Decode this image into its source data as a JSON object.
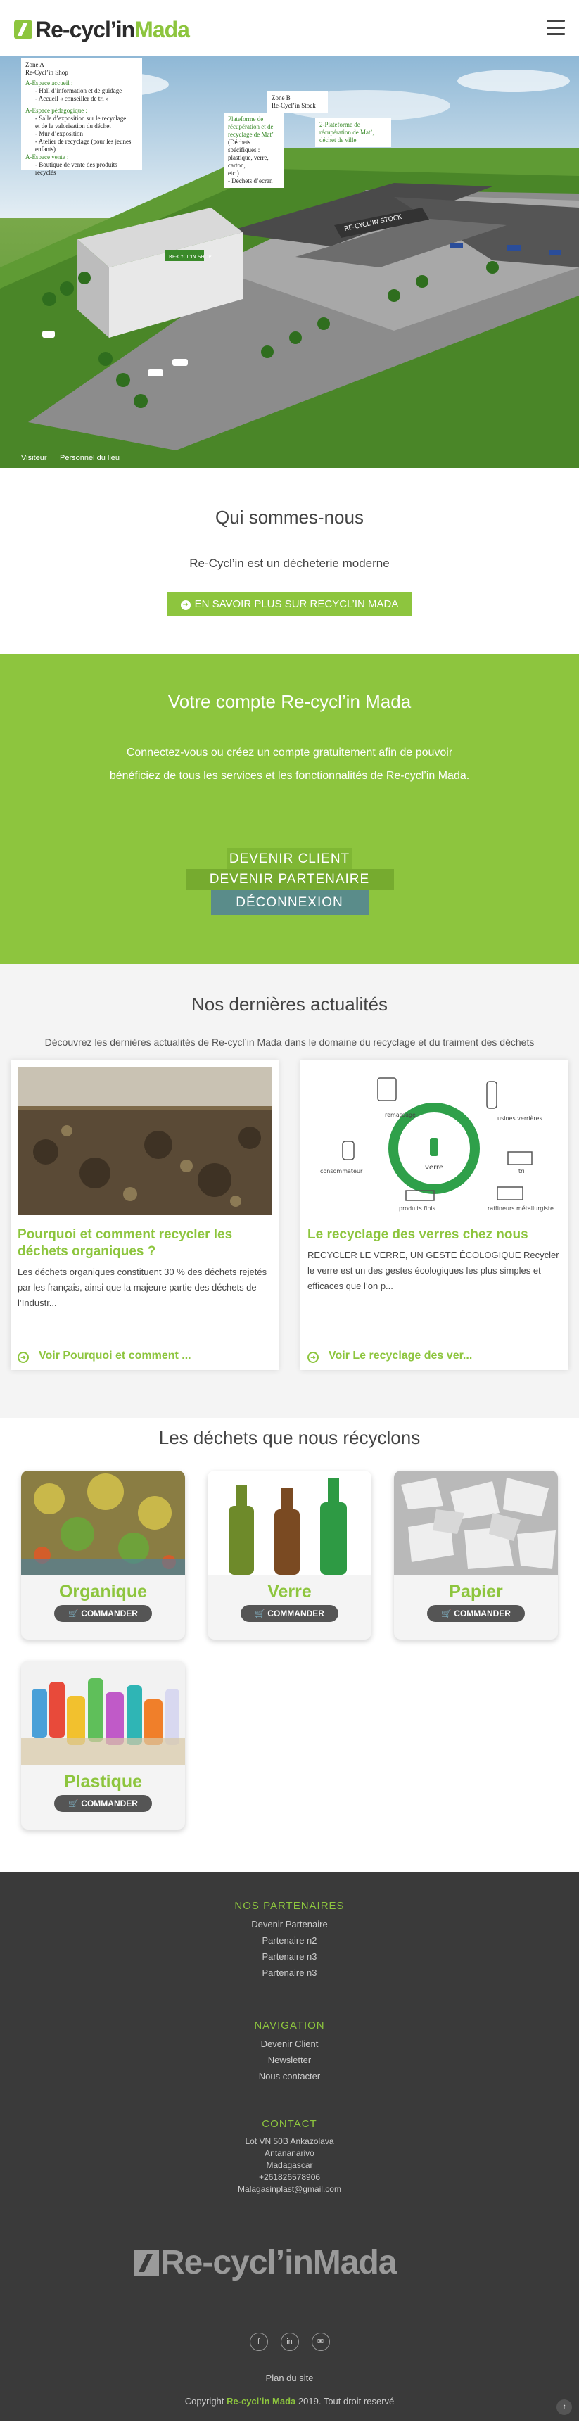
{
  "header": {
    "logo_main": "Re-cycl’in",
    "logo_accent": "Mada",
    "menu_icon": "hamburger-icon"
  },
  "hero": {
    "zone_a": {
      "title": "Zone A",
      "sub": "Re-Cycl’in Shop",
      "g1": "A-Espace accueil :",
      "l1": "- Hall d’information et de guidage",
      "l2": "- Accueil « conseiller de tri »",
      "g2": "A-Espace pédagogique :",
      "l3": "- Salle d’exposition sur le recyclage",
      "l4": "  et de la valorisation du déchet",
      "l5": "- Mur d’exposition",
      "l6": "- Atelier de recyclage (pour les jeunes",
      "l7": "  enfants)",
      "g3": "A-Espace vente :",
      "l8": "- Boutique de vente des produits recyclés"
    },
    "zone_b": {
      "title": "Zone B",
      "sub": "Re-Cycl’in Stock"
    },
    "platform": {
      "g": "Plateforme de récupération et de recyclage de Mat’",
      "l1": "(Déchets spécifiques :",
      "l2": "plastique, verre, carton,",
      "l3": "etc.)",
      "l4": "- Déchets d’ecran"
    },
    "platform2": {
      "g": "2-Plateforme de récupération de Mat’, déchet de ville"
    },
    "sign": "RE-CYCL’IN STOCK",
    "bldg_sign": "RE-CYCL’IN SHOP",
    "cap1": "Visiteur",
    "cap2": "Personnel du lieu"
  },
  "about": {
    "title": "Qui sommes-nous",
    "text": "Re-Cycl’in est un décheterie moderne",
    "button": "En savoir plus sur Recycl’in Mada",
    "button_icon": "arrow-right-icon"
  },
  "account": {
    "title": "Votre compte Re-cycl’in Mada",
    "text": "Connectez-vous ou créez un compte gratuitement afin de pouvoir bénéficiez de tous les services et les fonctionnalités de Re-cycl’in Mada.",
    "btn_client": "Devenir client",
    "btn_partner": "Devenir partenaire",
    "btn_logout": "Déconnexion"
  },
  "news": {
    "title": "Nos dernières actualités",
    "subtitle": "Découvrez les dernières actualités de Re-cycl’in Mada dans le domaine du recyclage et du traiment des déchets",
    "cards": [
      {
        "title": "Pourquoi et comment recycler les déchets organiques ?",
        "text": "Les déchets organiques constituent 30 % des déchets rejetés par les français, ainsi que la majeure partie des déchets de l’Industr...",
        "more": "Voir Pourquoi et comment ..."
      },
      {
        "title": "Le recyclage des verres chez nous",
        "text": "RECYCLER LE VERRE, UN GESTE ÉCOLOGIQUE Recycler le verre est un des gestes écologiques les plus simples et efficaces que l’on p...",
        "more": "Voir Le recyclage des ver...",
        "diagram": {
          "center": "verre",
          "top": "remassage",
          "right_top": "usines verrières",
          "right": "tri",
          "bottom_right": "raffineurs métallurgiste",
          "bottom": "produits finis",
          "left": "consommateur"
        }
      }
    ]
  },
  "waste": {
    "title": "Les déchets que nous récyclons",
    "command": "COMMANDER",
    "items": [
      "Organique",
      "Verre",
      "Papier",
      "Plastique"
    ]
  },
  "footer": {
    "partners_title": "Nos partenaires",
    "partners": [
      "Devenir Partenaire",
      "Partenaire n2",
      "Partenaire n3",
      "Partenaire n3"
    ],
    "nav_title": "Navigation",
    "nav": [
      "Devenir Client",
      "Newsletter",
      "Nous contacter"
    ],
    "contact_title": "Contact",
    "contact": [
      "Lot VN 50B Ankazolava",
      "Antananarivo",
      "Madagascar",
      "+261826578906",
      "Malagasinplast@gmail.com"
    ],
    "logo_main": "Re-cycl’in",
    "logo_accent": "Mada",
    "socials": [
      "f",
      "in",
      "✉"
    ],
    "plan": "Plan du site",
    "copy_pre": "Copyright",
    "copy_brand": "Re-cycl’in Mada",
    "copy_post": "2019. Tout droit reservé",
    "totop": "↑"
  },
  "colors": {
    "accent": "#8dc53e",
    "dark": "#3a3a3a",
    "teal": "#5a8c8a"
  }
}
